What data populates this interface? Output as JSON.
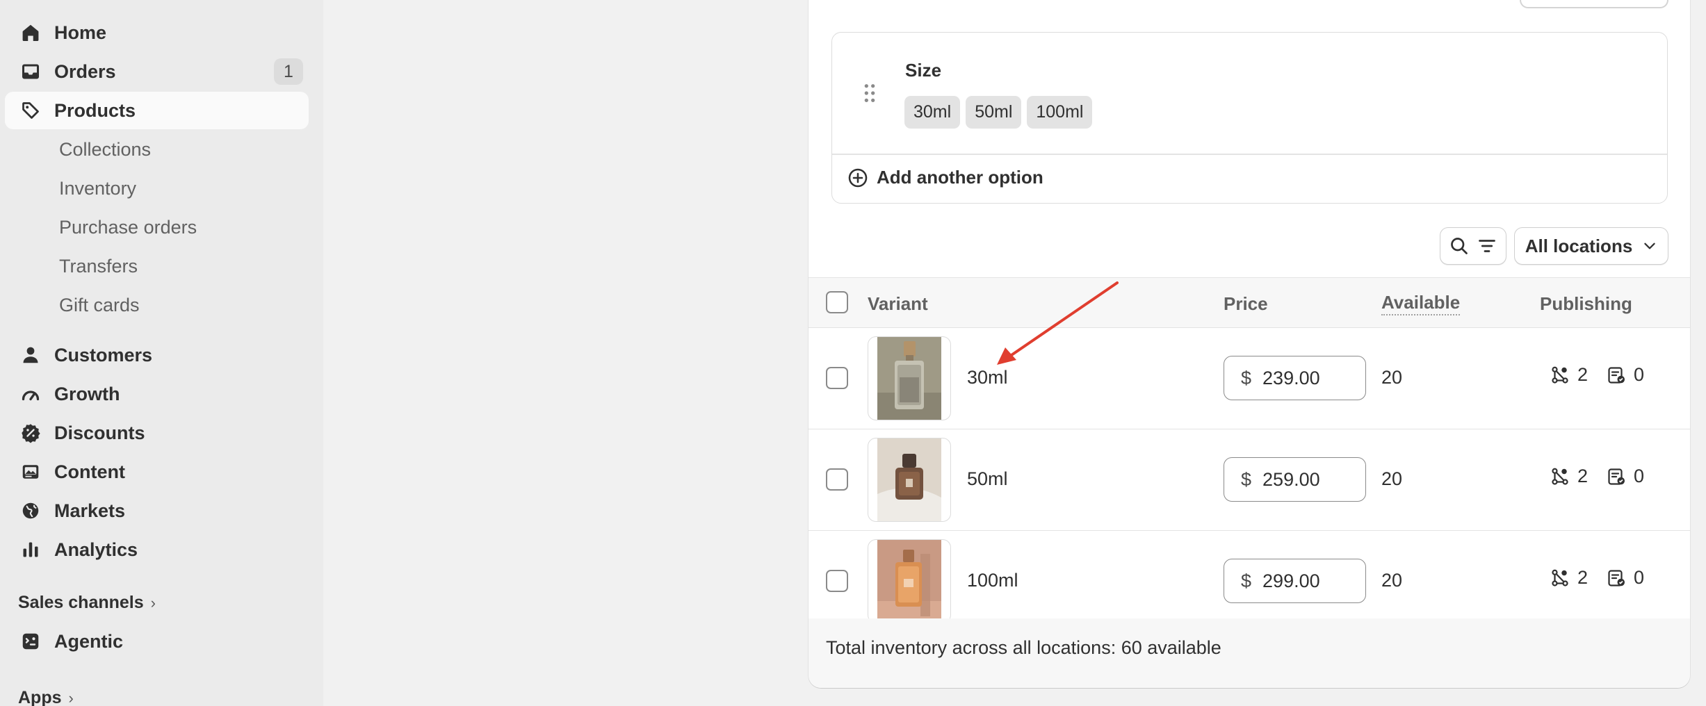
{
  "sidebar": {
    "items": [
      {
        "label": "Home",
        "icon": "home-icon"
      },
      {
        "label": "Orders",
        "icon": "inbox-icon",
        "badge": "1"
      },
      {
        "label": "Products",
        "icon": "tag-icon",
        "active": true
      },
      {
        "label": "Collections"
      },
      {
        "label": "Inventory"
      },
      {
        "label": "Purchase orders"
      },
      {
        "label": "Transfers"
      },
      {
        "label": "Gift cards"
      },
      {
        "label": "Customers",
        "icon": "person-icon"
      },
      {
        "label": "Growth",
        "icon": "gauge-icon"
      },
      {
        "label": "Discounts",
        "icon": "discount-icon"
      },
      {
        "label": "Content",
        "icon": "image-icon"
      },
      {
        "label": "Markets",
        "icon": "globe-icon"
      },
      {
        "label": "Analytics",
        "icon": "bar-chart-icon"
      },
      {
        "label": "Agentic",
        "icon": "agent-icon"
      }
    ],
    "sales_channels_label": "Sales channels",
    "apps_label": "Apps"
  },
  "options": {
    "name": "Size",
    "values": [
      "30ml",
      "50ml",
      "100ml"
    ],
    "add_label": "Add another option"
  },
  "toolbar": {
    "locations_label": "All locations"
  },
  "table": {
    "headers": {
      "variant": "Variant",
      "price": "Price",
      "available": "Available",
      "publishing": "Publishing"
    },
    "rows": [
      {
        "name": "30ml",
        "currency": "$",
        "price": "239.00",
        "available": "20",
        "channels": "2",
        "catalogs": "0"
      },
      {
        "name": "50ml",
        "currency": "$",
        "price": "259.00",
        "available": "20",
        "channels": "2",
        "catalogs": "0"
      },
      {
        "name": "100ml",
        "currency": "$",
        "price": "299.00",
        "available": "20",
        "channels": "2",
        "catalogs": "0"
      }
    ],
    "footer": "Total inventory across all locations: 60 available"
  },
  "colors": {
    "sidebar_bg": "#ebebeb",
    "page_bg": "#f1f1f1",
    "card_bg": "#ffffff",
    "annotation_arrow": "#e03e2f"
  }
}
